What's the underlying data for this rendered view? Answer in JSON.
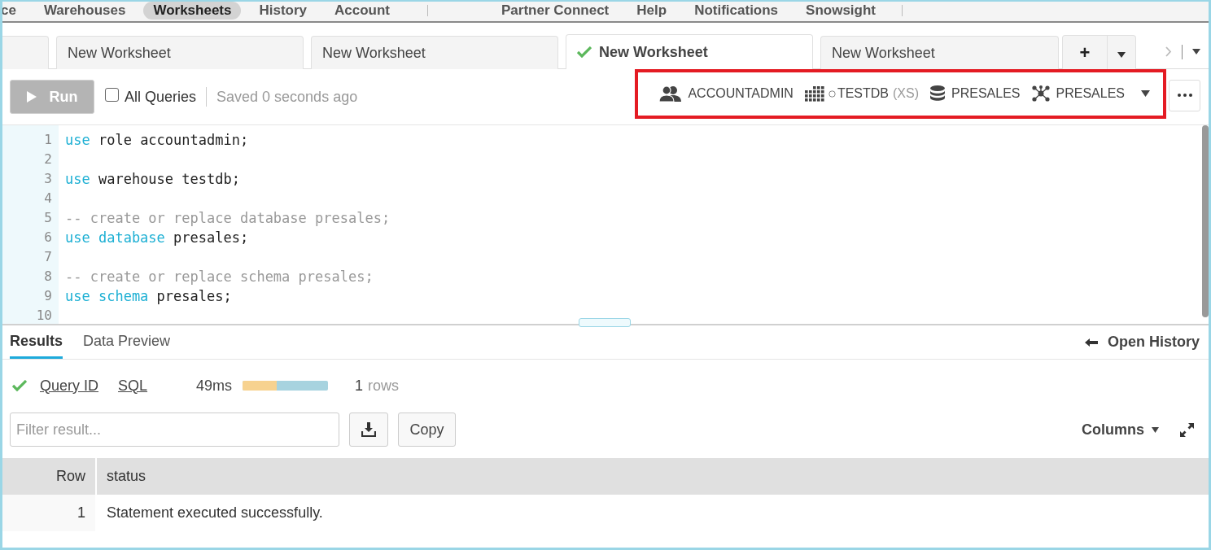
{
  "nav": {
    "items": [
      {
        "label": "ce",
        "selected": false
      },
      {
        "label": "Warehouses",
        "selected": false
      },
      {
        "label": "Worksheets",
        "selected": true
      },
      {
        "label": "History",
        "selected": false
      },
      {
        "label": "Account",
        "selected": false
      },
      {
        "kind": "separator"
      },
      {
        "label": "Partner Connect",
        "selected": false
      },
      {
        "label": "Help",
        "selected": false
      },
      {
        "label": "Notifications",
        "selected": false
      },
      {
        "label": "Snowsight",
        "selected": false
      },
      {
        "kind": "separator"
      }
    ]
  },
  "worksheet_tabs": [
    {
      "label": "New Worksheet",
      "selected": false,
      "saved": false
    },
    {
      "label": "New Worksheet",
      "selected": false,
      "saved": false
    },
    {
      "label": "New Worksheet",
      "selected": true,
      "saved": true
    },
    {
      "label": "New Worksheet",
      "selected": false,
      "saved": false
    }
  ],
  "add_tab": {
    "label": "+"
  },
  "toolbar": {
    "run": {
      "label": "Run",
      "disabled": true
    },
    "all_queries": {
      "label": "All Queries",
      "checked": false
    },
    "saved_status": "Saved 0 seconds ago"
  },
  "context": {
    "role": "ACCOUNTADMIN",
    "warehouse": "TESTDB",
    "warehouse_size": "(XS)",
    "database": "PRESALES",
    "schema": "PRESALES"
  },
  "editor": {
    "lines": [
      {
        "number": "1",
        "tokens": [
          {
            "kind": "keyword",
            "text": "use"
          },
          {
            "kind": "plain",
            "text": " role accountadmin;"
          }
        ]
      },
      {
        "number": "2"
      },
      {
        "number": "3",
        "tokens": [
          {
            "kind": "keyword",
            "text": "use"
          },
          {
            "kind": "plain",
            "text": " warehouse testdb;"
          }
        ]
      },
      {
        "number": "4"
      },
      {
        "number": "5",
        "tokens": [
          {
            "kind": "comment",
            "text": "-- create or replace database presales;"
          }
        ]
      },
      {
        "number": "6",
        "tokens": [
          {
            "kind": "keyword",
            "text": "use database"
          },
          {
            "kind": "plain",
            "text": " presales;"
          }
        ]
      },
      {
        "number": "7"
      },
      {
        "number": "8",
        "tokens": [
          {
            "kind": "comment",
            "text": "-- create or replace schema presales;"
          }
        ]
      },
      {
        "number": "9",
        "tokens": [
          {
            "kind": "keyword",
            "text": "use schema"
          },
          {
            "kind": "plain",
            "text": " presales;"
          }
        ]
      },
      {
        "number": "10"
      }
    ]
  },
  "result_tabs": [
    {
      "label": "Results",
      "selected": true
    },
    {
      "label": "Data Preview",
      "selected": false
    }
  ],
  "open_history": "Open History",
  "query_info": {
    "succeeded": true,
    "query_id": "Query ID",
    "sql": "SQL",
    "duration": "49ms",
    "level": 0.4,
    "row_count": "1",
    "row_unit": "rows"
  },
  "filter": {
    "placeholder": "Filter result..."
  },
  "copy_button": "Copy",
  "columns_button": "Columns",
  "table": {
    "columns": [
      "Row",
      "status"
    ],
    "rows": [
      [
        "1",
        "Statement executed successfully."
      ]
    ]
  }
}
